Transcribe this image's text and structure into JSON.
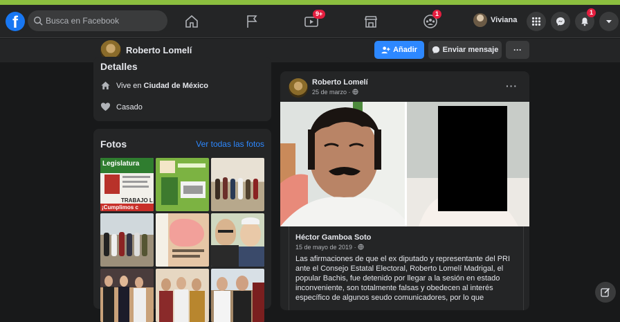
{
  "search": {
    "placeholder": "Busca en Facebook"
  },
  "nav": {
    "logo_letter": "f",
    "watch_badge": "9+",
    "groups_badge": "1",
    "user_name": "Viviana",
    "notifications_badge": "1"
  },
  "profile": {
    "name": "Roberto Lomelí",
    "add_label": "Añadir",
    "message_label": "Enviar mensaje",
    "more_label": "···"
  },
  "details": {
    "title": "Detalles",
    "lives_prefix": "Vive en",
    "lives_city": "Ciudad de México",
    "relationship": "Casado"
  },
  "photos": {
    "title": "Fotos",
    "see_all": "Ver todas las fotos",
    "tile1_top": "Legislatura",
    "tile1_mid": "TRABAJO L",
    "tile1_bottom": "¡Cumplimos c"
  },
  "post": {
    "author": "Roberto Lomelí",
    "date": "25 de marzo ·",
    "more": "···",
    "shared": {
      "author": "Héctor Gamboa Soto",
      "date": "15 de mayo de 2019 ·",
      "text": "Las afirmaciones de que el ex diputado y representante del PRI ante el Consejo Estatal Electoral, Roberto Lomelí Madrigal, el popular Bachis, fue detenido por llegar a la sesión en estado inconveniente, son totalmente falsas y obedecen al interés específico de algunos seudo comunicadores, por lo que"
    }
  },
  "colors": {
    "accent": "#2d88ff",
    "badge": "#e41e3f",
    "surface": "#242526",
    "background": "#18191a"
  }
}
